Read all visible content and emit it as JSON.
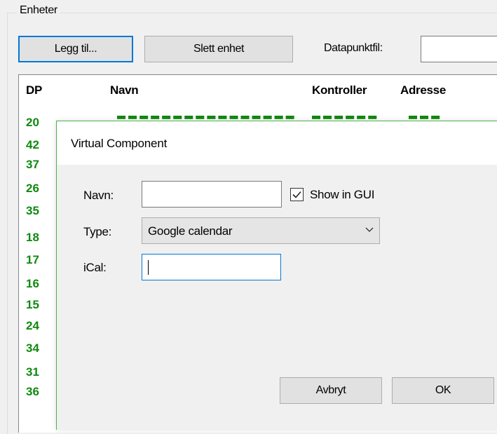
{
  "group": {
    "title": "Enheter"
  },
  "toolbar": {
    "add_label": "Legg til...",
    "delete_label": "Slett enhet",
    "datapoint_file_label": "Datapunktfil:",
    "datapoint_file_value": ""
  },
  "table": {
    "columns": [
      "DP",
      "Navn",
      "Kontroller",
      "Adresse"
    ],
    "dp_values": [
      "20",
      "42",
      "37",
      "26",
      "35",
      "18",
      "17",
      "16",
      "15",
      "24",
      "34",
      "31",
      "36"
    ]
  },
  "dialog": {
    "title": "Virtual Component",
    "name_label": "Navn:",
    "name_value": "",
    "show_in_gui_label": "Show in GUI",
    "show_in_gui_checked": true,
    "type_label": "Type:",
    "type_value": "Google calendar",
    "ical_label": "iCal:",
    "ical_value": "",
    "cancel_label": "Avbryt",
    "ok_label": "OK"
  },
  "colors": {
    "dp_text": "#108a10",
    "focus_border": "#0078d7",
    "dialog_border": "#4cb04c"
  }
}
